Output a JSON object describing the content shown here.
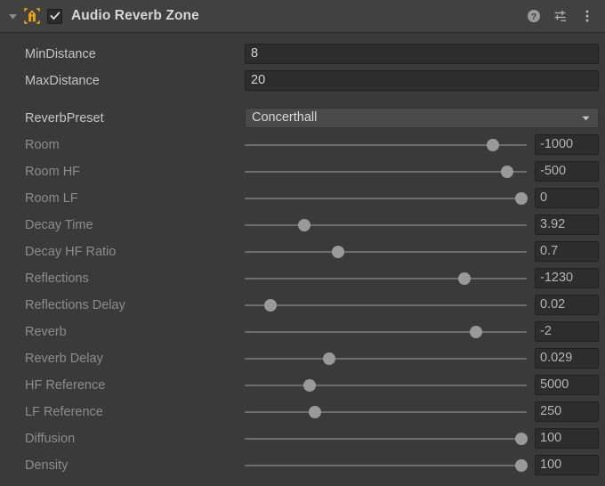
{
  "header": {
    "title": "Audio Reverb Zone",
    "foldout_icon": "triangle-down-icon",
    "component_icon": "audio-reverb-zone-icon",
    "component_icon_color": "#e8a317",
    "enabled": true,
    "enabled_icon": "checkmark-icon",
    "icons": [
      {
        "name": "help-icon",
        "glyph": "?"
      },
      {
        "name": "preset-sliders-icon",
        "glyph": "sliders"
      },
      {
        "name": "more-menu-icon",
        "glyph": "kebab"
      }
    ]
  },
  "theme": {
    "background": "#3a3a3a",
    "header_background": "#414141",
    "field_background": "#2d2d2d",
    "dropdown_background": "#4a4a4a",
    "label_color": "#c4c4c4",
    "dim_label_color": "#8c8c8c",
    "track_color": "#6d6d6d",
    "thumb_color": "#9a9a9a",
    "accent": "#e8a317"
  },
  "fields": [
    {
      "type": "text",
      "label": "MinDistance",
      "value": "8"
    },
    {
      "type": "text",
      "label": "MaxDistance",
      "value": "20"
    },
    {
      "type": "spacer"
    },
    {
      "type": "dropdown",
      "label": "ReverbPreset",
      "value": "Concerthall",
      "arrow_icon": "chevron-down-icon"
    },
    {
      "type": "slider",
      "label": "Room",
      "value": "-1000",
      "percent": 88
    },
    {
      "type": "slider",
      "label": "Room HF",
      "value": "-500",
      "percent": 93
    },
    {
      "type": "slider",
      "label": "Room LF",
      "value": "0",
      "percent": 98
    },
    {
      "type": "slider",
      "label": "Decay Time",
      "value": "3.92",
      "percent": 21
    },
    {
      "type": "slider",
      "label": "Decay HF Ratio",
      "value": "0.7",
      "percent": 33
    },
    {
      "type": "slider",
      "label": "Reflections",
      "value": "-1230",
      "percent": 78
    },
    {
      "type": "slider",
      "label": "Reflections Delay",
      "value": "0.02",
      "percent": 9
    },
    {
      "type": "slider",
      "label": "Reverb",
      "value": "-2",
      "percent": 82
    },
    {
      "type": "slider",
      "label": "Reverb Delay",
      "value": "0.029",
      "percent": 30
    },
    {
      "type": "slider",
      "label": "HF Reference",
      "value": "5000",
      "percent": 23
    },
    {
      "type": "slider",
      "label": "LF Reference",
      "value": "250",
      "percent": 25
    },
    {
      "type": "slider",
      "label": "Diffusion",
      "value": "100",
      "percent": 98
    },
    {
      "type": "slider",
      "label": "Density",
      "value": "100",
      "percent": 98
    }
  ]
}
